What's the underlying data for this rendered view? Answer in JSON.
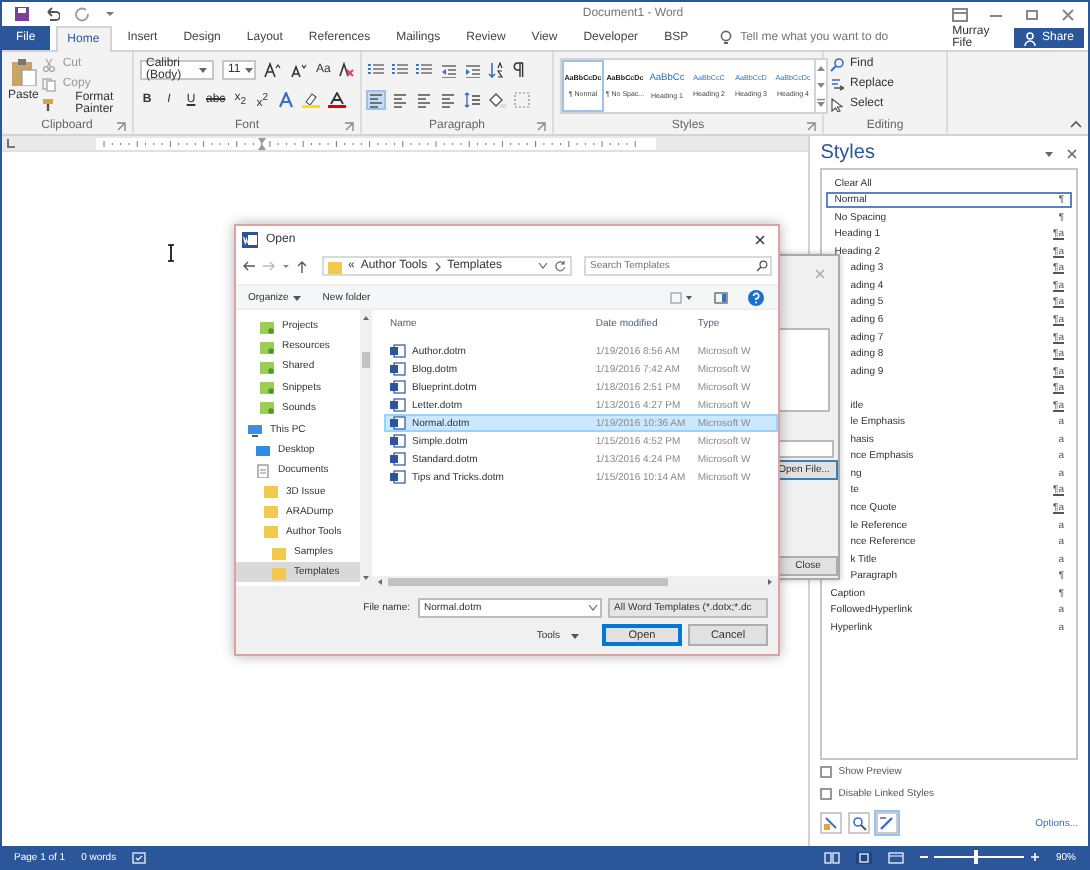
{
  "window": {
    "title": "Document1 - Word"
  },
  "ribbon_tabs": [
    {
      "label": "File",
      "kind": "file",
      "selected": false
    },
    {
      "label": "Home",
      "kind": "tab",
      "selected": true
    },
    {
      "label": "Insert",
      "kind": "tab",
      "selected": false
    },
    {
      "label": "Design",
      "kind": "tab",
      "selected": false
    },
    {
      "label": "Layout",
      "kind": "tab",
      "selected": false
    },
    {
      "label": "References",
      "kind": "tab",
      "selected": false
    },
    {
      "label": "Mailings",
      "kind": "tab",
      "selected": false
    },
    {
      "label": "Review",
      "kind": "tab",
      "selected": false
    },
    {
      "label": "View",
      "kind": "tab",
      "selected": false
    },
    {
      "label": "Developer",
      "kind": "tab",
      "selected": false
    },
    {
      "label": "BSP",
      "kind": "tab",
      "selected": false
    }
  ],
  "tell_me": {
    "placeholder": "Tell me what you want to do"
  },
  "user": "Murray Fife",
  "share_button": "Share",
  "clipboard": {
    "paste": "Paste",
    "cut": "Cut",
    "copy": "Copy",
    "format_painter": "Format Painter",
    "label": "Clipboard"
  },
  "font": {
    "name": "Calibri (Body)",
    "size": "11",
    "change_case": "Aa",
    "bold": "B",
    "italic": "I",
    "underline": "U",
    "strikethrough": "abc",
    "subscript": "x$_{2}$",
    "superscript": "x$^{2}$",
    "label": "Font"
  },
  "paragraph": {
    "label": "Paragraph"
  },
  "styles_gallery": {
    "label": "Styles",
    "items": [
      {
        "sample": "AaBbCcDc",
        "label": "¶ Normal",
        "kind": "normal",
        "selected": true
      },
      {
        "sample": "AaBbCcDc",
        "label": "¶ No Spac...",
        "kind": "normal",
        "selected": false
      },
      {
        "sample": "AaBbCc",
        "label": "Heading 1",
        "kind": "heading1",
        "selected": false
      },
      {
        "sample": "AaBbCcC",
        "label": "Heading 2",
        "kind": "heading",
        "selected": false
      },
      {
        "sample": "AaBbCcD",
        "label": "Heading 3",
        "kind": "heading",
        "selected": false
      },
      {
        "sample": "AaBbCcDc",
        "label": "Heading 4",
        "kind": "heading",
        "selected": false
      }
    ]
  },
  "editing": {
    "find": "Find",
    "replace": "Replace",
    "select": "Select",
    "label": "Editing"
  },
  "styles_pane": {
    "title": "Styles",
    "items": [
      {
        "name": "Clear All",
        "selected": false
      },
      {
        "name": "Normal",
        "symbol": "¶",
        "selected": true
      },
      {
        "name": "No Spacing",
        "symbol": "¶",
        "selected": false
      },
      {
        "name": "Heading 1",
        "symbol": "¶a",
        "selected": false
      },
      {
        "name": "Heading 2",
        "symbol": "¶a",
        "selected": false
      },
      {
        "name": "ading 3",
        "symbol": "¶a",
        "selected": false
      },
      {
        "name": "ading 4",
        "symbol": "¶a",
        "selected": false
      },
      {
        "name": "ading 5",
        "symbol": "¶a",
        "selected": false
      },
      {
        "name": "ading 6",
        "symbol": "¶a",
        "selected": false
      },
      {
        "name": "ading 7",
        "symbol": "¶a",
        "selected": false
      },
      {
        "name": "ading 8",
        "symbol": "¶a",
        "selected": false
      },
      {
        "name": "ading 9",
        "symbol": "¶a",
        "selected": false
      },
      {
        "symbol": "¶a",
        "selected": false
      },
      {
        "name": "itle",
        "symbol": "¶a",
        "selected": false
      },
      {
        "name": "le Emphasis",
        "symbol": "a",
        "selected": false
      },
      {
        "name": "hasis",
        "symbol": "a",
        "selected": false
      },
      {
        "name": "nce Emphasis",
        "symbol": "a",
        "selected": false
      },
      {
        "name": "ng",
        "symbol": "a",
        "selected": false
      },
      {
        "name": "te",
        "symbol": "¶a",
        "selected": false
      },
      {
        "name": "nce Quote",
        "symbol": "¶a",
        "selected": false
      },
      {
        "name": "le Reference",
        "symbol": "a",
        "selected": false
      },
      {
        "name": "nce Reference",
        "symbol": "a",
        "selected": false
      },
      {
        "name": "k Title",
        "symbol": "a",
        "selected": false
      },
      {
        "name": "Paragraph",
        "symbol": "¶",
        "selected": false
      },
      {
        "name": "Caption",
        "symbol": "¶",
        "selected": false
      },
      {
        "name": "FollowedHyperlink",
        "symbol": "a",
        "selected": false
      },
      {
        "name": "Hyperlink",
        "symbol": "a",
        "selected": false
      }
    ],
    "show_preview": {
      "label": "Show Preview",
      "checked": false
    },
    "disable_linked_styles": {
      "label": "Disable Linked Styles",
      "checked": false
    },
    "options_link": "Options..."
  },
  "background_dialog": {
    "open_file_button": "Open File...",
    "close_button": "Close"
  },
  "open_dialog": {
    "title": "Open",
    "path": [
      "«",
      "Author Tools",
      "Templates"
    ],
    "search": {
      "placeholder": "Search Templates"
    },
    "organize": "Organize",
    "new_folder": "New folder",
    "nav": [
      {
        "label": "Projects",
        "kind": "synced",
        "selected": false
      },
      {
        "label": "Resources",
        "kind": "synced",
        "selected": false
      },
      {
        "label": "Shared",
        "kind": "synced",
        "selected": false
      },
      {
        "label": "Snippets",
        "kind": "synced",
        "selected": false
      },
      {
        "label": "Sounds",
        "kind": "synced",
        "selected": false
      },
      {
        "label": "This PC",
        "kind": "pc",
        "selected": false,
        "children": [
          {
            "label": "Desktop",
            "kind": "desktop",
            "selected": false
          },
          {
            "label": "Documents",
            "kind": "documents",
            "selected": false,
            "children": [
              {
                "label": "3D Issue",
                "kind": "folder",
                "selected": false
              },
              {
                "label": "ARADump",
                "kind": "folder",
                "selected": false
              },
              {
                "label": "Author Tools",
                "kind": "folder",
                "selected": false,
                "children": [
                  {
                    "label": "Samples",
                    "kind": "folder",
                    "selected": false
                  },
                  {
                    "label": "Templates",
                    "kind": "folder",
                    "selected": true
                  }
                ]
              }
            ]
          }
        ]
      }
    ],
    "columns": [
      "Name",
      "Date modified",
      "Type"
    ],
    "rows": [
      {
        "name": "Author.dotm",
        "date": "1/19/2016 8:56 AM",
        "type": "Microsoft W",
        "selected": false
      },
      {
        "name": "Blog.dotm",
        "date": "1/19/2016 7:42 AM",
        "type": "Microsoft W",
        "selected": false
      },
      {
        "name": "Blueprint.dotm",
        "date": "1/18/2016 2:51 PM",
        "type": "Microsoft W",
        "selected": false
      },
      {
        "name": "Letter.dotm",
        "date": "1/13/2016 4:27 PM",
        "type": "Microsoft W",
        "selected": false
      },
      {
        "name": "Normal.dotm",
        "date": "1/19/2016 10:36 AM",
        "type": "Microsoft W",
        "selected": true
      },
      {
        "name": "Simple.dotm",
        "date": "1/15/2016 4:52 PM",
        "type": "Microsoft W",
        "selected": false
      },
      {
        "name": "Standard.dotm",
        "date": "1/13/2016 4:24 PM",
        "type": "Microsoft W",
        "selected": false
      },
      {
        "name": "Tips and Tricks.dotm",
        "date": "1/15/2016 10:14 AM",
        "type": "Microsoft W",
        "selected": false
      }
    ],
    "file_name_label": "File name:",
    "file_name": "Normal.dotm",
    "file_type": "All Word Templates (*.dotx;*.dc",
    "tools": "Tools",
    "open_button": "Open",
    "cancel_button": "Cancel"
  },
  "status_bar": {
    "page": "Page 1 of 1",
    "words": "0 words",
    "zoom": "90%",
    "zoom_slider": {
      "level": 0.45
    }
  }
}
